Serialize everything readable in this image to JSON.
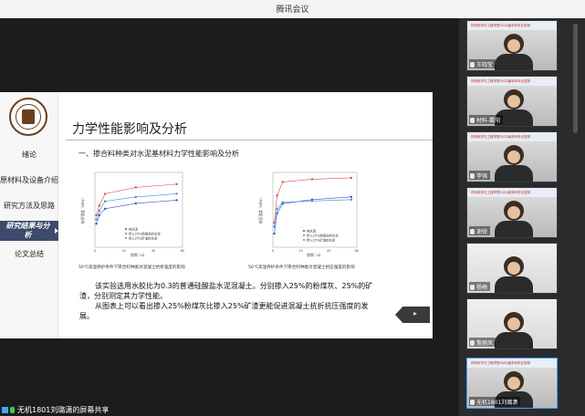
{
  "window": {
    "title": "腾讯会议"
  },
  "slide": {
    "nav": [
      "绪论",
      "原材料及设备介绍",
      "研究方法及思路",
      "研究结果与分析",
      "论文总结"
    ],
    "active_nav": 3,
    "title": "力学性能影响及分析",
    "section": "一、掺合料种类对水泥基材料力学性能影响及分析",
    "caption1": "50℃高温养护条件下掺合料种类对混凝土抗折强度的影响",
    "caption2": "50℃高温养护条件下掺合料种类对混凝土抗压强度的影响",
    "para": [
      "该实验选用水胶比为0.3的普通硅酸盐水泥混凝土。分别掺入25%的粉煤灰、25%的矿",
      "渣，分别测定其力学性能。",
      "从图表上可以看出掺入25%粉煤灰比掺入25%矿渣更能促进混凝土抗折抗压强度的发",
      "展。"
    ],
    "next_icon": "next-page-icon"
  },
  "chart_data": [
    {
      "type": "line",
      "xlabel": "龄期（d）",
      "ylabel": "抗折强度（MPa）",
      "x": [
        1,
        3,
        7,
        28,
        56
      ],
      "series": [
        {
          "name": "纯水泥",
          "values": [
            5.2,
            6.0,
            6.6,
            7.1,
            7.4
          ],
          "color": "#3b4fbf"
        },
        {
          "name": "掺入25%粉煤灰的水泥",
          "values": [
            6.0,
            6.9,
            8.0,
            8.6,
            8.9
          ],
          "color": "#e04a4a"
        },
        {
          "name": "掺入25%矿渣的水泥",
          "values": [
            5.6,
            6.4,
            7.3,
            7.7,
            8.0
          ],
          "color": "#3a8fd8"
        }
      ]
    },
    {
      "type": "line",
      "xlabel": "龄期（d）",
      "ylabel": "抗压强度（MPa）",
      "x": [
        1,
        3,
        7,
        28,
        56
      ],
      "series": [
        {
          "name": "纯水泥",
          "values": [
            40,
            55,
            62,
            65,
            67
          ],
          "color": "#3b4fbf"
        },
        {
          "name": "掺入25%粉煤灰的水泥",
          "values": [
            48,
            68,
            78,
            80,
            81
          ],
          "color": "#e04a4a"
        },
        {
          "name": "掺入25%矿渣的水泥",
          "values": [
            45,
            58,
            63,
            64,
            65
          ],
          "color": "#3a8fd8"
        }
      ]
    }
  ],
  "presenter": {
    "label": "无机1801刘璐潇的屏幕共享"
  },
  "participants": [
    {
      "name": "王晓莹",
      "banner": "材料科学与工程学院2022届本科毕业答辩",
      "selected": false
    },
    {
      "name": "材料-戴阳",
      "banner": "材料科学与工程学院2022届本科毕业答辩",
      "selected": false
    },
    {
      "name": "李强",
      "banner": "材料科学与工程学院2022届本科毕业答辩",
      "selected": false
    },
    {
      "name": "谢锐",
      "banner": "材料科学与工程学院2022届本科毕业答辩",
      "selected": false
    },
    {
      "name": "杨梅",
      "banner": "",
      "selected": false
    },
    {
      "name": "詹丽凤",
      "banner": "",
      "selected": false
    },
    {
      "name": "无机1801刘璐潇",
      "banner": "材料科学与工程学院2022届本科毕业答辩",
      "selected": true
    }
  ]
}
